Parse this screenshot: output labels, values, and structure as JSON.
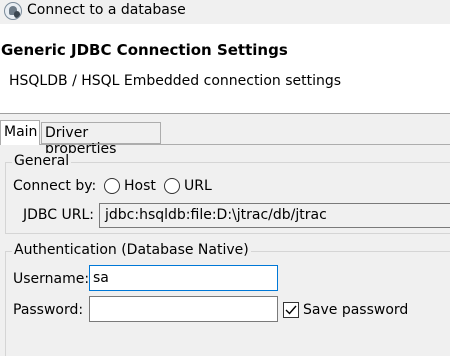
{
  "window": {
    "title": "Connect to a database",
    "icon": "database-icon"
  },
  "header": {
    "title": "Generic JDBC Connection Settings",
    "subtitle": "HSQLDB / HSQL Embedded connection settings"
  },
  "tabs": [
    {
      "label": "Main",
      "selected": true
    },
    {
      "label": "Driver properties",
      "selected": false
    }
  ],
  "general": {
    "legend": "General",
    "connect_by_label": "Connect by:",
    "options": [
      {
        "label": "Host",
        "selected": false
      },
      {
        "label": "URL",
        "selected": false
      }
    ],
    "jdbc_url_label": "JDBC URL:",
    "jdbc_url_value": "jdbc:hsqldb:file:D:\\jtrac/db/jtrac"
  },
  "authentication": {
    "legend": "Authentication (Database Native)",
    "username_label": "Username:",
    "username_value": "sa",
    "password_label": "Password:",
    "password_value": "",
    "save_password_label": "Save password",
    "save_password_checked": true
  },
  "colors": {
    "focus_border": "#0078d7",
    "header_bg": "#ffffff",
    "dialog_bg": "#f0f0f0"
  }
}
